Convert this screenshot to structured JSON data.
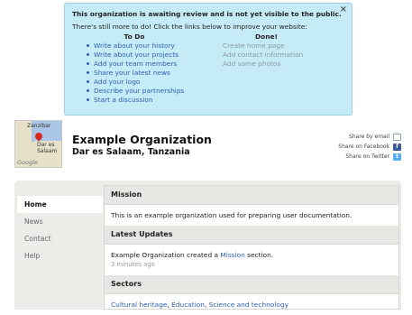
{
  "notice": {
    "headline": "This organization is awaiting review and is not yet visible to the public.",
    "subline": "There's still more to do! Click the links below to improve your website:",
    "close_icon": "×",
    "todo_heading": "To Do",
    "done_heading": "Done!",
    "todo_items": [
      "Write about your history",
      "Write about your projects",
      "Add your team members",
      "Share your latest news",
      "Add your logo",
      "Describe your partnerships",
      "Start a discussion"
    ],
    "done_items": [
      "Create home page",
      "Add contact information",
      "Add some photos"
    ]
  },
  "org": {
    "name": "Example Organization",
    "location": "Dar es Salaam, Tanzania",
    "map": {
      "label_top": "Zanzibar",
      "label_city": "Dar es Salaam",
      "google": "Google"
    }
  },
  "share": {
    "email": "Share by email",
    "facebook": "Share on Facebook",
    "twitter": "Share on Twitter"
  },
  "nav": [
    "Home",
    "News",
    "Contact",
    "Help"
  ],
  "sections": {
    "mission_title": "Mission",
    "mission_text": "This is an example organization used for preparing user documentation.",
    "updates_title": "Latest Updates",
    "update_prefix": "Example Organization created a ",
    "update_link": "Mission",
    "update_suffix": " section.",
    "update_time": "3 minutes ago",
    "sectors_title": "Sectors",
    "sectors": [
      "Cultural heritage",
      "Education",
      "Science and technology"
    ]
  },
  "colors": {
    "notice_bg": "#c5ebf6",
    "link": "#2b5fb3",
    "section_head": "#e9e7e4"
  }
}
